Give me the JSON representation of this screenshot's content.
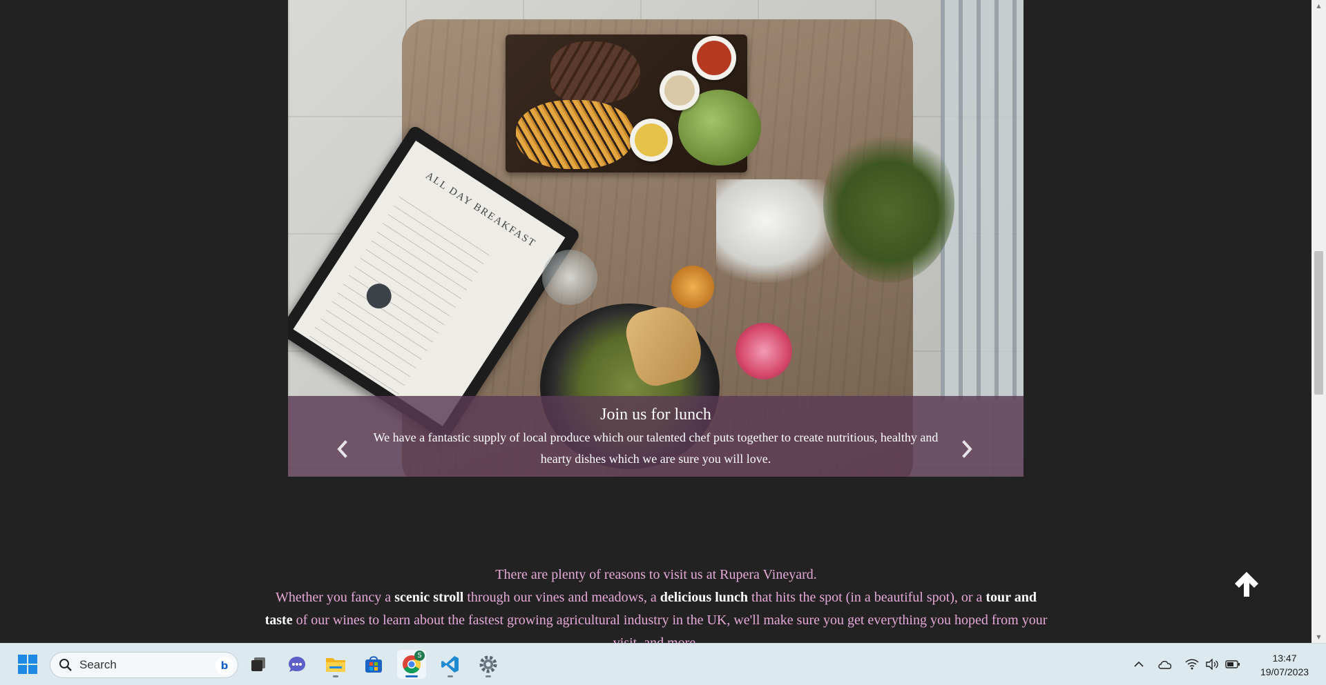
{
  "carousel": {
    "caption_title": "Join us for lunch",
    "caption_text": "We have a fantastic supply of local produce which our talented chef puts together to create nutritious, healthy and hearty dishes which we are sure you will love.",
    "photo_menu_title": "ALL DAY BREAKFAST",
    "prev_icon": "chevron-left-icon",
    "next_icon": "chevron-right-icon"
  },
  "intro": {
    "line1": "There are plenty of reasons to visit us at Rupera Vineyard.",
    "p1": "Whether you fancy a ",
    "b1": "scenic stroll",
    "p2": " through our vines and meadows, a ",
    "b2": "delicious lunch",
    "p3": " that hits the spot (in a beautiful spot), or a ",
    "b3": "tour and taste",
    "p4": " of our wines to learn about the fastest growing agricultural industry in the UK, we'll make sure you get everything you hoped from your visit, and more."
  },
  "back_to_top_icon": "arrow-up-icon",
  "colors": {
    "page_background": "#222222",
    "caption_band": "#5c3a54",
    "intro_text": "#e5a9d8",
    "emphasis_text": "#ffffff",
    "taskbar": "#dce9ef"
  },
  "taskbar": {
    "search_label": "Search",
    "apps": [
      "start-icon",
      "search-icon",
      "task-view-icon",
      "teams-chat-icon",
      "file-explorer-icon",
      "microsoft-store-icon",
      "chrome-icon",
      "vscode-icon",
      "settings-icon"
    ],
    "chrome_badge": "S",
    "tray": [
      "chevron-up-icon",
      "onedrive-cloud-icon",
      "wifi-icon",
      "volume-icon",
      "battery-icon"
    ],
    "time": "13:47",
    "date": "19/07/2023"
  }
}
